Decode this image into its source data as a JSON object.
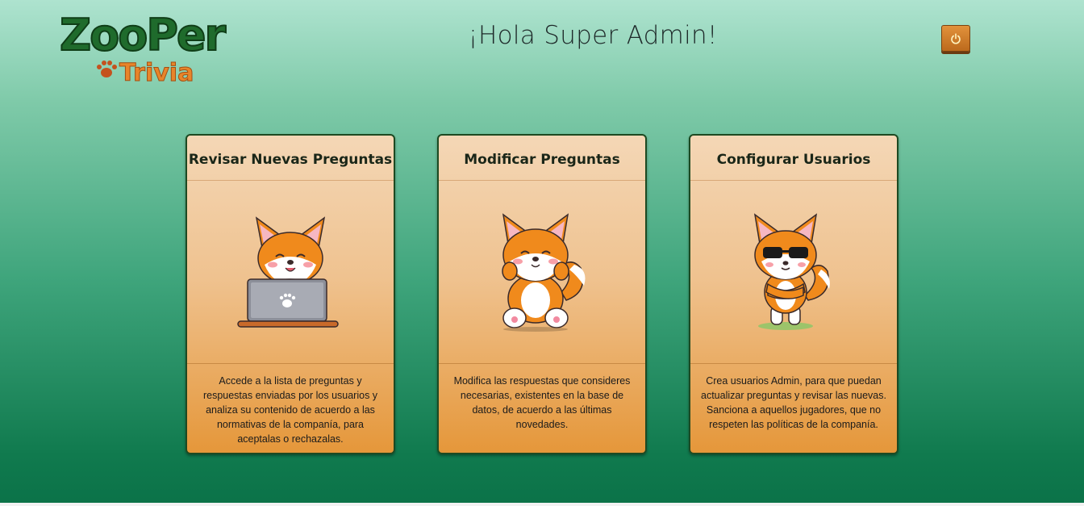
{
  "logo": {
    "top_text": "ZooPer",
    "bottom_text": "Trivia"
  },
  "header": {
    "greeting": "¡Hola Super Admin!",
    "logout_icon": "power-icon"
  },
  "colors": {
    "card_border": "#1d4a22",
    "logo_green": "#1f6b2c",
    "logo_orange": "#e8852a",
    "fox_orange": "#f08a1c"
  },
  "cards": [
    {
      "title": "Revisar Nuevas Preguntas",
      "image": "fox-laptop-illustration",
      "description": "Accede a la lista de preguntas y respuestas enviadas por los usuarios y analiza su contenido de acuerdo a las normativas de la companía, para aceptalas o rechazalas."
    },
    {
      "title": "Modificar Preguntas",
      "image": "fox-sitting-illustration",
      "description": "Modifica las respuestas que consideres necesarias, existentes en la base de datos, de acuerdo a las últimas novedades."
    },
    {
      "title": "Configurar Usuarios",
      "image": "fox-sunglasses-illustration",
      "description": "Crea usuarios Admin, para que puedan actualizar preguntas y revisar las nuevas. Sanciona a aquellos jugadores, que no respeten las políticas de la companía."
    }
  ]
}
